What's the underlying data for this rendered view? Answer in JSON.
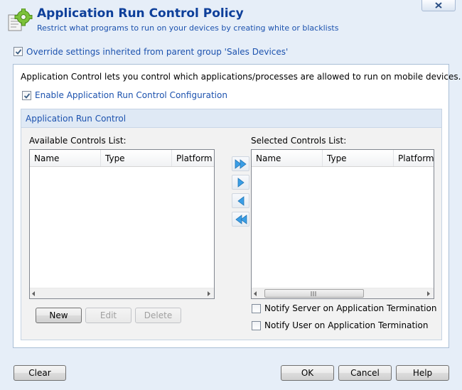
{
  "header": {
    "title": "Application Run Control Policy",
    "subtitle": "Restrict what programs to run on your devices by creating white or blacklists",
    "icon": "gear-document-icon",
    "close_icon": "close-icon"
  },
  "override": {
    "label": "Override settings inherited from parent group 'Sales Devices'",
    "checked": true
  },
  "panel": {
    "description": "Application Control lets you control which applications/processes are allowed to run on mobile devices.",
    "enable": {
      "label": "Enable Application Run Control Configuration",
      "checked": true
    },
    "group": {
      "title": "Application Run Control",
      "available": {
        "label": "Available Controls List:",
        "columns": [
          "Name",
          "Type",
          "Platform"
        ],
        "rows": []
      },
      "selected": {
        "label": "Selected Controls List:",
        "columns": [
          "Name",
          "Type",
          "Platform"
        ],
        "rows": []
      },
      "move_buttons": [
        "move-all-right-icon",
        "move-right-icon",
        "move-left-icon",
        "move-all-left-icon"
      ],
      "list_buttons": {
        "new": "New",
        "edit": "Edit",
        "delete": "Delete"
      },
      "notify_server": {
        "label": "Notify Server on Application Termination",
        "checked": false
      },
      "notify_user": {
        "label": "Notify User on Application Termination",
        "checked": false
      }
    }
  },
  "footer": {
    "clear": "Clear",
    "ok": "OK",
    "cancel": "Cancel",
    "help": "Help"
  },
  "colors": {
    "background": "#e6eef8",
    "title": "#0d3f9a",
    "accent_text": "#1c52ae",
    "arrow_fill": "#3a9ee6"
  }
}
